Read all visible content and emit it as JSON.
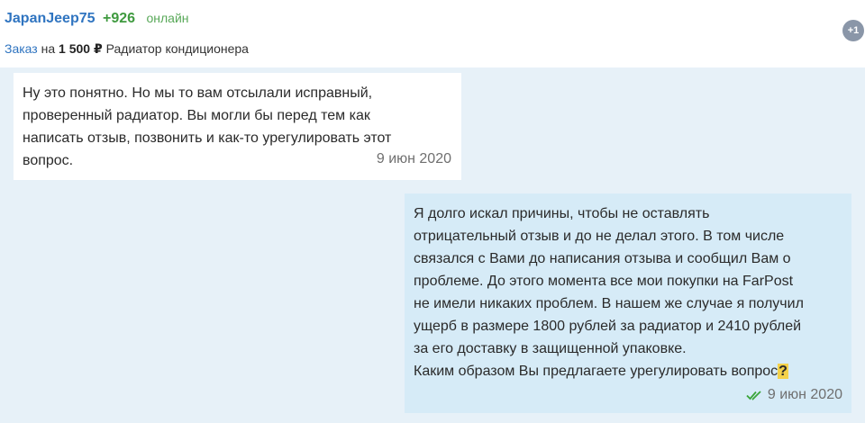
{
  "header": {
    "username": "JapanJeep75",
    "rating": "+926",
    "status": "онлайн",
    "order": {
      "link_label": "Заказ",
      "preposition": "на",
      "price": "1 500 ₽",
      "item": "Радиатор кондиционера"
    },
    "badge": "+1"
  },
  "messages": [
    {
      "direction": "incoming",
      "text": "Ну это понятно. Но мы то вам отсылали исправный,\nпроверенный радиатор. Вы могли бы перед тем как\nнаписать отзыв, позвонить и как-то урегулировать этот\nвопрос.",
      "date": "9 июн 2020"
    },
    {
      "direction": "outgoing",
      "text": "Я долго искал причины, чтобы не оставлять\nотрицательный отзыв и до не делал этого. В том числе\nсвязался с Вами до написания отзыва и сообщил Вам о\nпроблеме. До этого момента все мои покупки на FarPost\nне имели никаких проблем. В нашем же случае я получил\nущерб в размере 1800 рублей за радиатор и 2410 рублей\nза его доставку в защищенной упаковке.\nКаким образом Вы предлагаете урегулировать вопрос",
      "question_mark": "?",
      "date": "9 июн 2020",
      "read_icon": "double-check-icon",
      "read_color": "#3aa53a"
    }
  ]
}
